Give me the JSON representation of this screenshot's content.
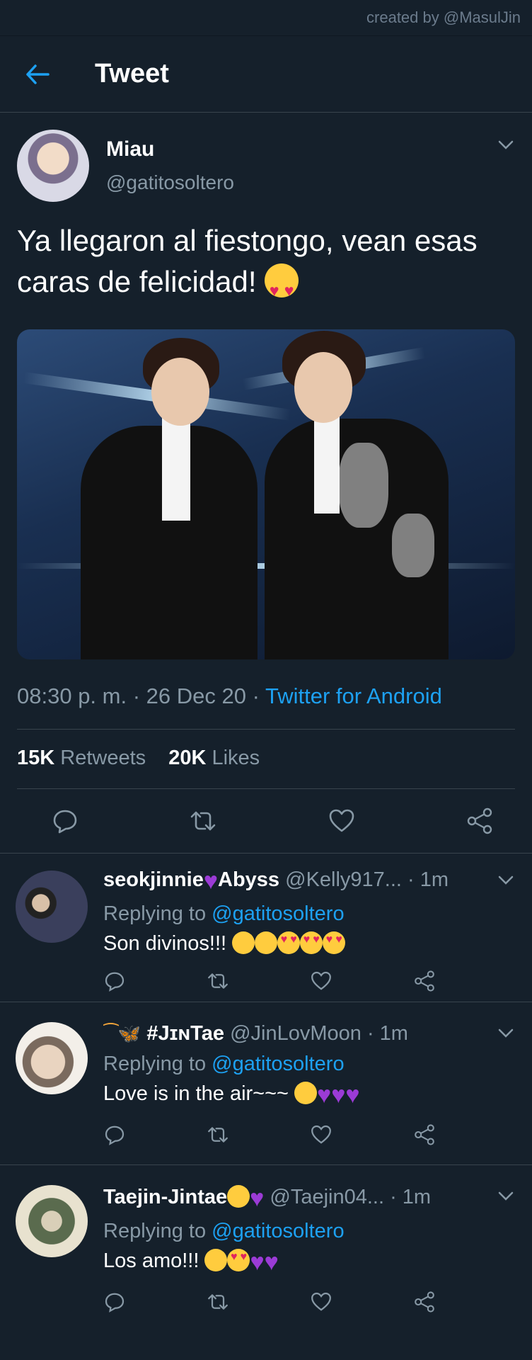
{
  "credit": "created by @MasulJin",
  "header": {
    "title": "Tweet"
  },
  "tweet": {
    "author_name": "Miau",
    "author_handle": "@gatitosoltero",
    "text": "Ya llegaron al fiestongo, vean esas caras de felicidad!",
    "time": "08:30 p. m.",
    "date": "26 Dec 20",
    "source": "Twitter for Android",
    "retweets_count": "15K",
    "retweets_label": "Retweets",
    "likes_count": "20K",
    "likes_label": "Likes"
  },
  "replies": [
    {
      "name": "seokjinnie",
      "name_suffix": "Abyss",
      "handle": "@Kelly917...",
      "time": "· 1m",
      "replying_label": "Replying to",
      "replying_to": "@gatitosoltero",
      "text": "Son divinos!!!"
    },
    {
      "name": "#JɪɴTae",
      "handle": "@JinLovMoon",
      "time": "· 1m",
      "replying_label": "Replying to",
      "replying_to": "@gatitosoltero",
      "text": "Love is in the air~~~"
    },
    {
      "name": "Taejin-Jintae",
      "handle": "@Taejin04...",
      "time": "· 1m",
      "replying_label": "Replying to",
      "replying_to": "@gatitosoltero",
      "text": "Los amo!!!"
    }
  ],
  "colors": {
    "background": "#15202b",
    "accent": "#1da1f2",
    "muted": "#8899a6",
    "divider": "#38444d"
  },
  "icons": [
    "back-arrow-icon",
    "chevron-down-icon",
    "reply-icon",
    "retweet-icon",
    "like-icon",
    "share-icon"
  ]
}
